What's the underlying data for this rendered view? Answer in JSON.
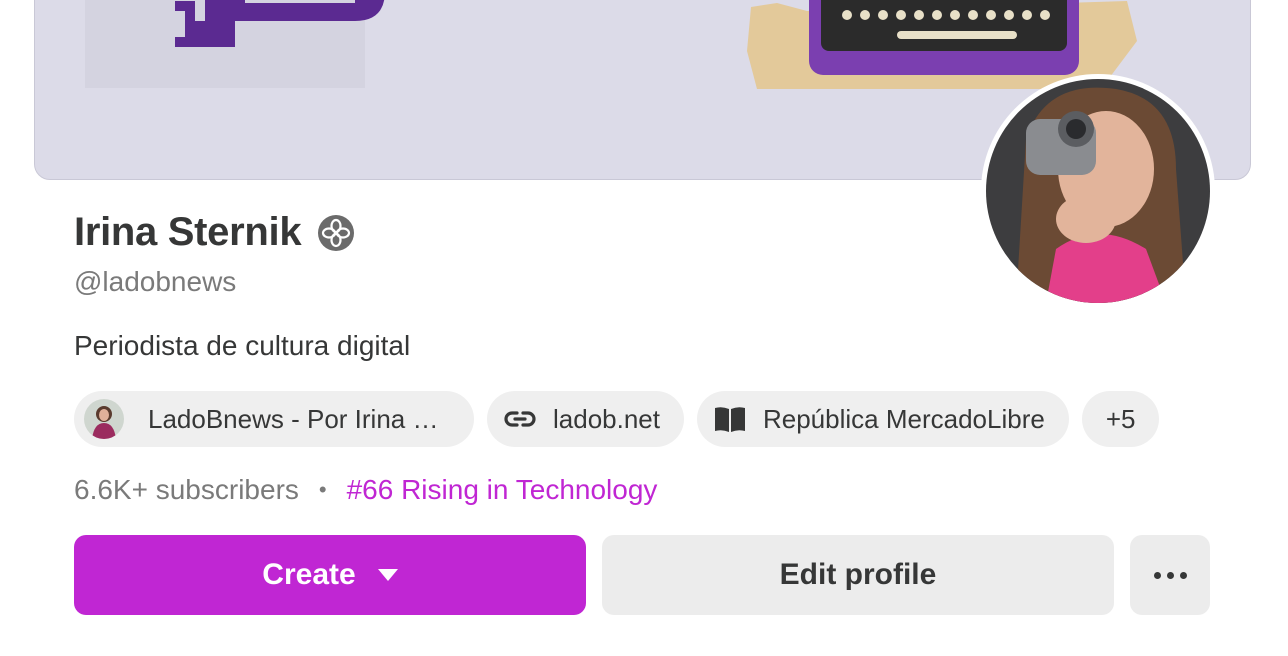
{
  "profile": {
    "name": "Irina Sternik",
    "handle": "@ladobnews",
    "bio": "Periodista de cultura digital",
    "verified_icon": "badge-icon"
  },
  "chips": {
    "publication": "LadoBnews - Por Irina S...",
    "website": "ladob.net",
    "book": "República MercadoLibre",
    "more": "+5"
  },
  "stats": {
    "subscribers": "6.6K+ subscribers",
    "separator": "•",
    "rank": "#66 Rising in Technology"
  },
  "buttons": {
    "create": "Create",
    "edit_profile": "Edit profile"
  },
  "colors": {
    "accent": "#c026d3",
    "banner": "#dcdbe8",
    "chip_bg": "#efefef"
  }
}
